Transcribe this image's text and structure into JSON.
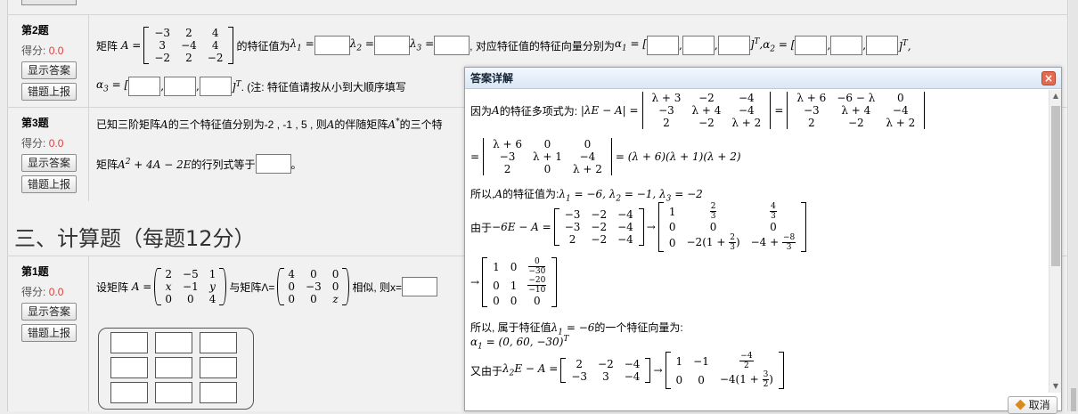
{
  "questions": {
    "q2": {
      "title": "第2题",
      "score_label": "得分:",
      "score_value": "0.0",
      "show_answer": "显示答案",
      "report_error": "错题上报",
      "text_matrix_a": "矩阵",
      "text_eigen": "的特征值为",
      "text_vectors": ", 对应特征值的特征向量分别为",
      "note": ". (注: 特征值请按从小到大顺序填写"
    },
    "q3": {
      "title": "第3题",
      "score_label": "得分:",
      "score_value": "0.0",
      "show_answer": "显示答案",
      "report_error": "错题上报",
      "line1": "已知三阶矩阵",
      "line1b": "的三个特征值分别为-2 , -1 , 5 , 则",
      "line1c": "的伴随矩阵",
      "line1d": "的三个特",
      "line2a": "矩阵",
      "line2b": "的行列式等于",
      "line2c": "。"
    },
    "section": "三、计算题（每题12分）",
    "c1": {
      "title": "第1题",
      "score_label": "得分:",
      "score_value": "0.0",
      "show_answer": "显示答案",
      "report_error": "错题上报",
      "text1": "设矩阵",
      "text2": "与矩阵Λ=",
      "text3": "相似, 则x="
    }
  },
  "dialog": {
    "title": "答案详解",
    "cancel": "取消",
    "l1": "因为",
    "l1b": "的特征多项式为:",
    "l3": "所以,",
    "l3b": "的特征值为:",
    "l4": "由于",
    "l6": "所以, 属于特征值",
    "l6b": "的一个特征向量为:",
    "l8": "又由于"
  },
  "colors": {
    "score": "#e23b3b",
    "dialog_border": "#7ea7d6",
    "close": "#e56b4e"
  }
}
